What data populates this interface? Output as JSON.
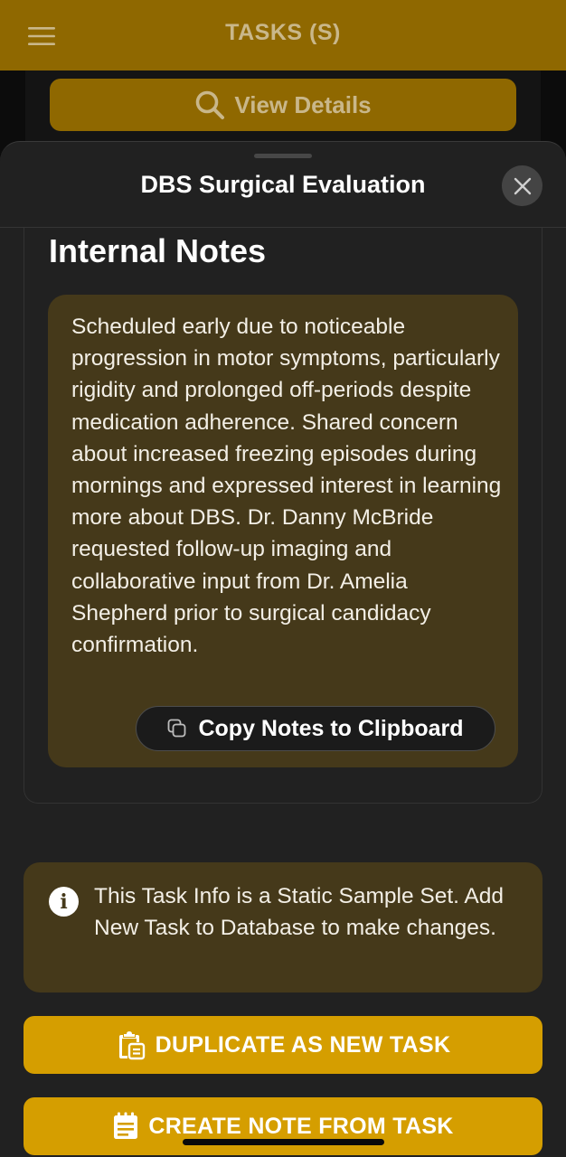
{
  "app_bar": {
    "title": "TASKS (S)",
    "menu_icon": "hamburger-menu-icon",
    "background_color": "#8f6800"
  },
  "view_details": {
    "label": "View Details",
    "icon": "search-icon"
  },
  "sheet": {
    "title": "DBS Surgical Evaluation",
    "close_icon": "close-icon",
    "internal_notes": {
      "heading": "Internal Notes",
      "body": "Scheduled early due to noticeable progression in motor symptoms, particularly rigidity and prolonged off-periods despite medication adherence. Shared concern about increased freezing episodes during mornings and expressed interest in learning more about DBS. Dr. Danny McBride requested follow-up imaging and collaborative input from Dr. Amelia Shepherd prior to surgical candidacy confirmation.",
      "copy_button_label": "Copy Notes to Clipboard",
      "copy_icon": "copy-icon"
    },
    "info_banner": {
      "text": "This Task Info is a Static Sample Set. Add New Task to Database to make changes.",
      "icon": "info-icon"
    },
    "actions": {
      "duplicate_label": "DUPLICATE AS NEW TASK",
      "duplicate_icon": "clipboard-duplicate-icon",
      "create_note_label": "CREATE NOTE FROM TASK",
      "create_note_icon": "notepad-icon"
    }
  },
  "colors": {
    "accent": "#d59e00",
    "notes_background": "#45391a",
    "sheet_background": "#212121"
  }
}
